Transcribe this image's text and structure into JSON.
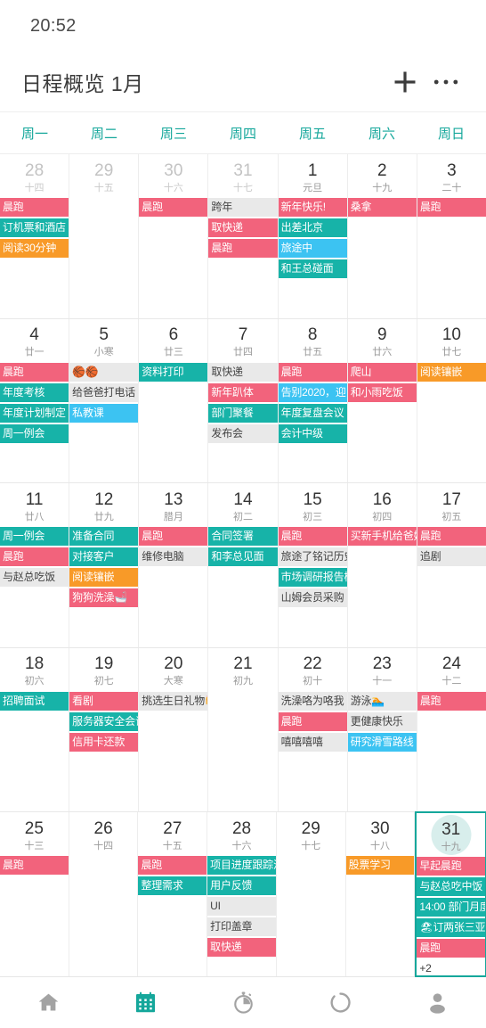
{
  "status_bar": {
    "clock": "20:52"
  },
  "header": {
    "title": "日程概览  1月",
    "add_label": "+",
    "more_label": "···",
    "add_icon": "plus-icon",
    "more_icon": "ellipsis-icon"
  },
  "weekdays": [
    "周一",
    "周二",
    "周三",
    "周四",
    "周五",
    "周六",
    "周日"
  ],
  "colors": {
    "accent": "#15a79b",
    "event_pink": "#f2637c",
    "event_teal": "#17b3a8",
    "event_orange": "#f89a28",
    "event_blue": "#3cc3f2",
    "event_gray": "#e9e9e9",
    "today_circle": "#d8eeec"
  },
  "weeks": [
    {
      "days": [
        {
          "num": "28",
          "sub": "十四",
          "out": true,
          "today": false,
          "events": [
            {
              "text": "晨跑",
              "color": "pink"
            },
            {
              "text": "订机票和酒店",
              "color": "teal"
            },
            {
              "text": "阅读30分钟",
              "color": "orange"
            }
          ]
        },
        {
          "num": "29",
          "sub": "十五",
          "out": true,
          "today": false,
          "events": []
        },
        {
          "num": "30",
          "sub": "十六",
          "out": true,
          "today": false,
          "events": [
            {
              "text": "晨跑",
              "color": "pink"
            }
          ]
        },
        {
          "num": "31",
          "sub": "十七",
          "out": true,
          "today": false,
          "events": [
            {
              "text": "跨年",
              "color": "gray"
            },
            {
              "text": "取快递",
              "color": "pink"
            },
            {
              "text": "晨跑",
              "color": "pink"
            }
          ]
        },
        {
          "num": "1",
          "sub": "元旦",
          "out": false,
          "today": false,
          "events": [
            {
              "text": "新年快乐!",
              "color": "pink"
            },
            {
              "text": "出差北京",
              "color": "teal"
            },
            {
              "text": "旅途中",
              "color": "blue"
            },
            {
              "text": "和王总碰面",
              "color": "teal"
            }
          ]
        },
        {
          "num": "2",
          "sub": "十九",
          "out": false,
          "today": false,
          "events": [
            {
              "text": "桑拿",
              "color": "pink"
            }
          ]
        },
        {
          "num": "3",
          "sub": "二十",
          "out": false,
          "today": false,
          "events": [
            {
              "text": "晨跑",
              "color": "pink"
            }
          ]
        }
      ]
    },
    {
      "days": [
        {
          "num": "4",
          "sub": "廿一",
          "out": false,
          "today": false,
          "events": [
            {
              "text": "晨跑",
              "color": "pink"
            },
            {
              "text": "年度考核",
              "color": "teal"
            },
            {
              "text": "年度计划制定",
              "color": "teal"
            },
            {
              "text": "周一例会",
              "color": "teal"
            }
          ]
        },
        {
          "num": "5",
          "sub": "小寒",
          "out": false,
          "today": false,
          "events": [
            {
              "text": "🏀🏀",
              "color": "gray"
            },
            {
              "text": "给爸爸打电话",
              "color": "gray"
            },
            {
              "text": "私教课",
              "color": "blue"
            }
          ]
        },
        {
          "num": "6",
          "sub": "廿三",
          "out": false,
          "today": false,
          "events": [
            {
              "text": "资料打印",
              "color": "teal"
            }
          ]
        },
        {
          "num": "7",
          "sub": "廿四",
          "out": false,
          "today": false,
          "events": [
            {
              "text": "取快递",
              "color": "gray"
            },
            {
              "text": "新年趴体",
              "color": "pink"
            },
            {
              "text": "部门聚餐",
              "color": "teal"
            },
            {
              "text": "发布会",
              "color": "gray"
            }
          ]
        },
        {
          "num": "8",
          "sub": "廿五",
          "out": false,
          "today": false,
          "events": [
            {
              "text": "晨跑",
              "color": "pink"
            },
            {
              "text": "告别2020，迎",
              "color": "blue"
            },
            {
              "text": "年度复盘会议",
              "color": "teal"
            },
            {
              "text": "会计中级",
              "color": "teal"
            }
          ]
        },
        {
          "num": "9",
          "sub": "廿六",
          "out": false,
          "today": false,
          "events": [
            {
              "text": "爬山",
              "color": "pink"
            },
            {
              "text": "和小雨吃饭",
              "color": "pink"
            }
          ]
        },
        {
          "num": "10",
          "sub": "廿七",
          "out": false,
          "today": false,
          "events": [
            {
              "text": "阅读镶嵌",
              "color": "orange"
            }
          ]
        }
      ]
    },
    {
      "days": [
        {
          "num": "11",
          "sub": "廿八",
          "out": false,
          "today": false,
          "events": [
            {
              "text": "周一例会",
              "color": "teal"
            },
            {
              "text": "晨跑",
              "color": "pink"
            },
            {
              "text": "与赵总吃饭",
              "color": "gray"
            }
          ]
        },
        {
          "num": "12",
          "sub": "廿九",
          "out": false,
          "today": false,
          "events": [
            {
              "text": "准备合同",
              "color": "teal"
            },
            {
              "text": "对接客户",
              "color": "teal"
            },
            {
              "text": "阅读镶嵌",
              "color": "orange"
            },
            {
              "text": "狗狗洗澡🛁",
              "color": "pink"
            }
          ]
        },
        {
          "num": "13",
          "sub": "腊月",
          "out": false,
          "today": false,
          "events": [
            {
              "text": "晨跑",
              "color": "pink"
            },
            {
              "text": "维修电脑",
              "color": "gray"
            }
          ]
        },
        {
          "num": "14",
          "sub": "初二",
          "out": false,
          "today": false,
          "events": [
            {
              "text": "合同签署",
              "color": "teal"
            },
            {
              "text": "和李总见面",
              "color": "teal"
            }
          ]
        },
        {
          "num": "15",
          "sub": "初三",
          "out": false,
          "today": false,
          "events": [
            {
              "text": "晨跑",
              "color": "pink"
            },
            {
              "text": "旅途了铭记历史",
              "color": "gray"
            },
            {
              "text": "市场调研报告模",
              "color": "teal"
            },
            {
              "text": "山姆会员采购",
              "color": "gray"
            }
          ]
        },
        {
          "num": "16",
          "sub": "初四",
          "out": false,
          "today": false,
          "events": [
            {
              "text": "买新手机给爸妈",
              "color": "pink"
            }
          ]
        },
        {
          "num": "17",
          "sub": "初五",
          "out": false,
          "today": false,
          "events": [
            {
              "text": "晨跑",
              "color": "pink"
            },
            {
              "text": "追剧",
              "color": "gray"
            }
          ]
        }
      ]
    },
    {
      "days": [
        {
          "num": "18",
          "sub": "初六",
          "out": false,
          "today": false,
          "events": [
            {
              "text": "招聘面试",
              "color": "teal"
            }
          ]
        },
        {
          "num": "19",
          "sub": "初七",
          "out": false,
          "today": false,
          "events": [
            {
              "text": "看剧",
              "color": "pink"
            },
            {
              "text": "服务器安全会议",
              "color": "teal"
            },
            {
              "text": "信用卡还款",
              "color": "pink"
            }
          ]
        },
        {
          "num": "20",
          "sub": "大寒",
          "out": false,
          "today": false,
          "events": [
            {
              "text": "挑选生日礼物🎁",
              "color": "gray"
            }
          ]
        },
        {
          "num": "21",
          "sub": "初九",
          "out": false,
          "today": false,
          "events": []
        },
        {
          "num": "22",
          "sub": "初十",
          "out": false,
          "today": false,
          "events": [
            {
              "text": "洗澡咯为咯我",
              "color": "gray"
            },
            {
              "text": "晨跑",
              "color": "pink"
            },
            {
              "text": "嘻嘻嘻嘻",
              "color": "gray"
            }
          ]
        },
        {
          "num": "23",
          "sub": "十一",
          "out": false,
          "today": false,
          "events": [
            {
              "text": "游泳🏊",
              "color": "gray"
            },
            {
              "text": "更健康快乐",
              "color": "gray"
            },
            {
              "text": "研究滑雪路线",
              "color": "blue"
            }
          ]
        },
        {
          "num": "24",
          "sub": "十二",
          "out": false,
          "today": false,
          "events": [
            {
              "text": "晨跑",
              "color": "pink"
            }
          ]
        }
      ]
    },
    {
      "days": [
        {
          "num": "25",
          "sub": "十三",
          "out": false,
          "today": false,
          "events": [
            {
              "text": "晨跑",
              "color": "pink"
            }
          ]
        },
        {
          "num": "26",
          "sub": "十四",
          "out": false,
          "today": false,
          "events": []
        },
        {
          "num": "27",
          "sub": "十五",
          "out": false,
          "today": false,
          "events": [
            {
              "text": "晨跑",
              "color": "pink"
            },
            {
              "text": "整理需求",
              "color": "teal"
            }
          ]
        },
        {
          "num": "28",
          "sub": "十六",
          "out": false,
          "today": false,
          "events": [
            {
              "text": "项目进度跟踪汇",
              "color": "teal"
            },
            {
              "text": "用户反馈",
              "color": "teal"
            },
            {
              "text": "UI",
              "color": "gray"
            },
            {
              "text": "打印盖章",
              "color": "gray"
            },
            {
              "text": "取快递",
              "color": "pink"
            }
          ]
        },
        {
          "num": "29",
          "sub": "十七",
          "out": false,
          "today": false,
          "events": []
        },
        {
          "num": "30",
          "sub": "十八",
          "out": false,
          "today": false,
          "events": [
            {
              "text": "股票学习",
              "color": "orange"
            }
          ]
        },
        {
          "num": "31",
          "sub": "十九",
          "out": false,
          "today": true,
          "events": [
            {
              "text": "早起晨跑",
              "color": "pink"
            },
            {
              "text": "与赵总吃中饭",
              "color": "teal"
            },
            {
              "text": "14:00 部门月度",
              "color": "teal"
            },
            {
              "text": "🏖订两张三亚的",
              "color": "teal"
            },
            {
              "text": "晨跑",
              "color": "pink"
            },
            {
              "text": "+2",
              "color": "more"
            }
          ]
        }
      ]
    }
  ],
  "nav": {
    "items": [
      {
        "icon": "home-icon",
        "active": false
      },
      {
        "icon": "calendar-icon",
        "active": true
      },
      {
        "icon": "timer-icon",
        "active": false
      },
      {
        "icon": "progress-ring-icon",
        "active": false
      },
      {
        "icon": "profile-icon",
        "active": false
      }
    ]
  }
}
